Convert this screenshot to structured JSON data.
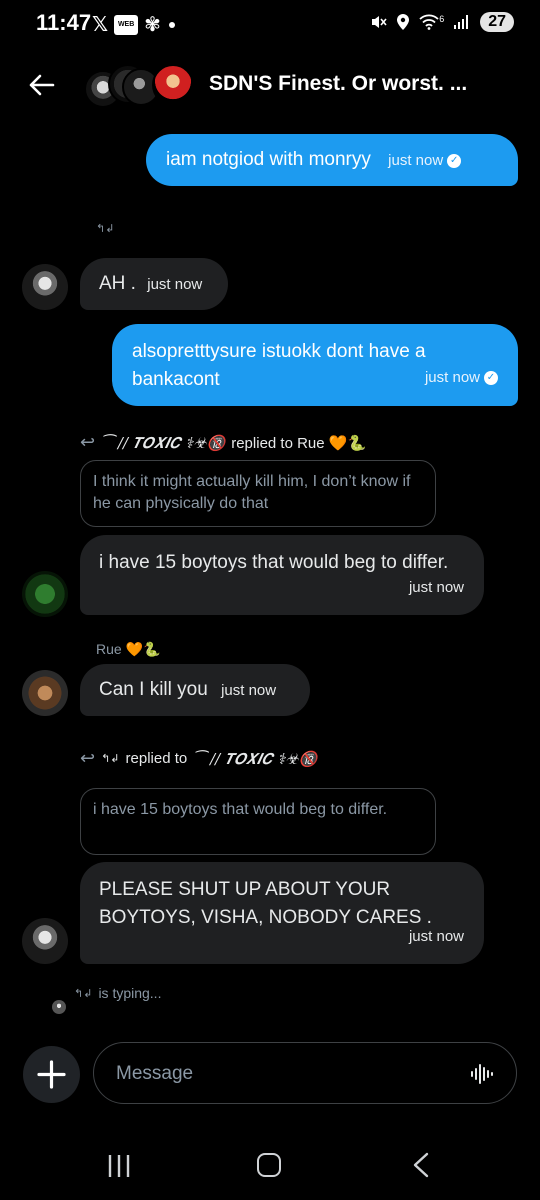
{
  "status_bar": {
    "time": "11:47",
    "x_glyph": "𝕏",
    "toon_badge": "WEB TOON",
    "flower_glyph": "✾",
    "signal_label": "6",
    "battery": "27"
  },
  "header": {
    "title": "SDN'S Finest. Or worst. ..."
  },
  "messages": {
    "m1": {
      "text": "iam notgiod with monryy",
      "time": "just now"
    },
    "sym_label_1": "↰↲",
    "m2": {
      "text": "AH .",
      "time": "just now"
    },
    "m3": {
      "text": "alsopretttysure istuokk dont have a bankacont",
      "time": "just now"
    },
    "reply1": {
      "from": "⁀ // 𝑻𝑶𝑿𝑰𝑪 ⚕☣🔞",
      "text": "replied to Rue 🧡🐍",
      "quote": "I think it might actually kill him, I don’t know if he can physically do that"
    },
    "m4": {
      "text": "i have 15 boytoys that would beg to differ.",
      "time": "just now"
    },
    "m5": {
      "sender": "Rue 🧡🐍",
      "text": "Can I kill you",
      "time": "just now"
    },
    "reply2": {
      "from": "↰↲",
      "text": "replied to",
      "to": "⁀ // 𝑻𝑶𝑿𝑰𝑪 ⚕☣🔞",
      "quote": "i have 15 boytoys that would beg to differ."
    },
    "m6": {
      "text": "PLEASE SHUT UP ABOUT YOUR BOYTOYS, VISHA, NOBODY CARES .",
      "time": "just now"
    },
    "typing": {
      "from": "↰↲",
      "text": "is typing..."
    }
  },
  "composer": {
    "placeholder": "Message"
  },
  "colors": {
    "accent": "#1d9bf0",
    "incoming_bubble": "#1f2022",
    "background": "#000000"
  },
  "icons": [
    "back-arrow-icon",
    "plus-icon",
    "voice-wave-icon",
    "reply-arrow-icon",
    "check-icon",
    "recent-apps-icon",
    "home-icon",
    "nav-back-icon"
  ]
}
